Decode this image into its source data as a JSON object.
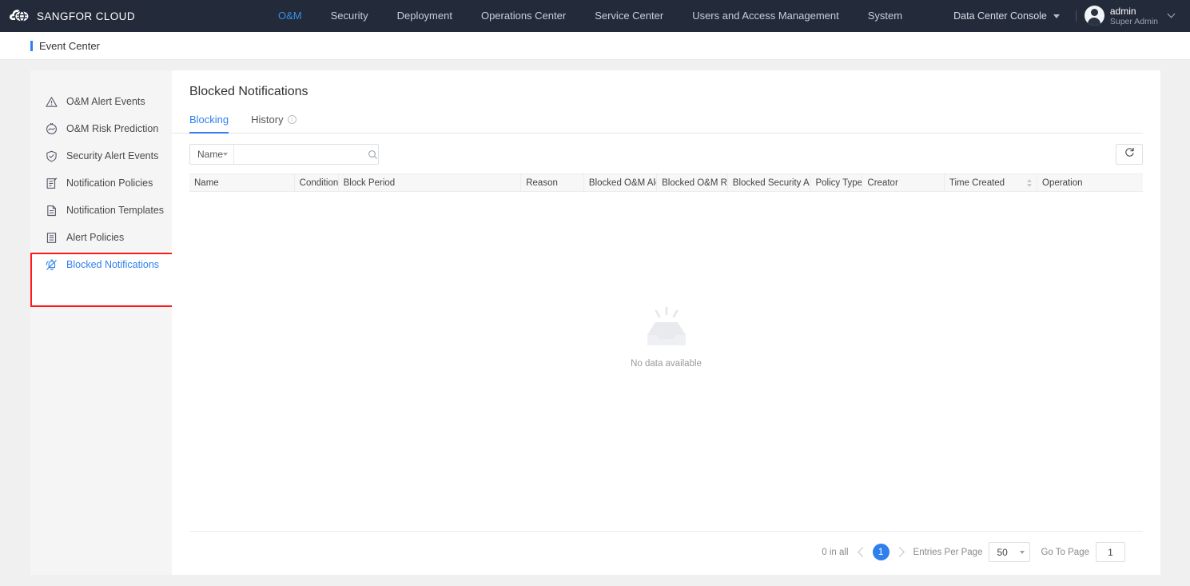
{
  "header": {
    "brand": "SANGFOR CLOUD",
    "logo_icon": "cloud-logo-icon",
    "nav": [
      {
        "label": "O&M",
        "active": true
      },
      {
        "label": "Security",
        "active": false
      },
      {
        "label": "Deployment",
        "active": false
      },
      {
        "label": "Operations Center",
        "active": false
      },
      {
        "label": "Service Center",
        "active": false
      },
      {
        "label": "Users and Access Management",
        "active": false
      },
      {
        "label": "System",
        "active": false
      }
    ],
    "console_selector": "Data Center Console",
    "user": {
      "name": "admin",
      "role": "Super Admin"
    }
  },
  "breadcrumb": {
    "label": "Event Center"
  },
  "sidebar": {
    "items": [
      {
        "label": "O&M Alert Events",
        "icon": "warning-triangle-icon",
        "active": false
      },
      {
        "label": "O&M Risk Prediction",
        "icon": "risk-prediction-icon",
        "active": false
      },
      {
        "label": "Security Alert Events",
        "icon": "shield-check-icon",
        "active": false
      },
      {
        "label": "Notification Policies",
        "icon": "document-edit-icon",
        "active": false
      },
      {
        "label": "Notification Templates",
        "icon": "document-icon",
        "active": false
      },
      {
        "label": "Alert Policies",
        "icon": "list-document-icon",
        "active": false
      },
      {
        "label": "Blocked Notifications",
        "icon": "bell-muted-icon",
        "active": true
      }
    ]
  },
  "main": {
    "title": "Blocked Notifications",
    "tabs": [
      {
        "label": "Blocking",
        "active": true,
        "info": false
      },
      {
        "label": "History",
        "active": false,
        "info": true
      }
    ],
    "toolbar": {
      "filter_field": "Name",
      "search_placeholder": "",
      "search_value": "",
      "search_icon": "search-icon",
      "refresh_icon": "refresh-icon"
    },
    "table": {
      "columns": [
        {
          "label": "Name",
          "sortable": false
        },
        {
          "label": "Conditions",
          "sortable": false
        },
        {
          "label": "Block Period",
          "sortable": false
        },
        {
          "label": "Reason",
          "sortable": false
        },
        {
          "label": "Blocked O&M Alerts",
          "sortable": false
        },
        {
          "label": "Blocked O&M Risks",
          "sortable": false
        },
        {
          "label": "Blocked Security Alerts",
          "sortable": false
        },
        {
          "label": "Policy Type",
          "sortable": false
        },
        {
          "label": "Creator",
          "sortable": false
        },
        {
          "label": "Time Created",
          "sortable": true
        },
        {
          "label": "Operation",
          "sortable": false
        }
      ],
      "rows": [],
      "empty_text": "No data available",
      "empty_icon": "empty-inbox-icon"
    },
    "pagination": {
      "total_text": "0 in all",
      "current_page": "1",
      "entries_label": "Entries Per Page",
      "entries_value": "50",
      "goto_label": "Go To Page",
      "goto_value": "1"
    }
  },
  "colors": {
    "header_bg": "#232b3a",
    "accent": "#2f80ed",
    "nav_active": "#3a8ee6",
    "highlight_box": "#ff1a1a",
    "sidebar_bg": "#f5f5f5",
    "page_bg": "#f0f0f0"
  }
}
